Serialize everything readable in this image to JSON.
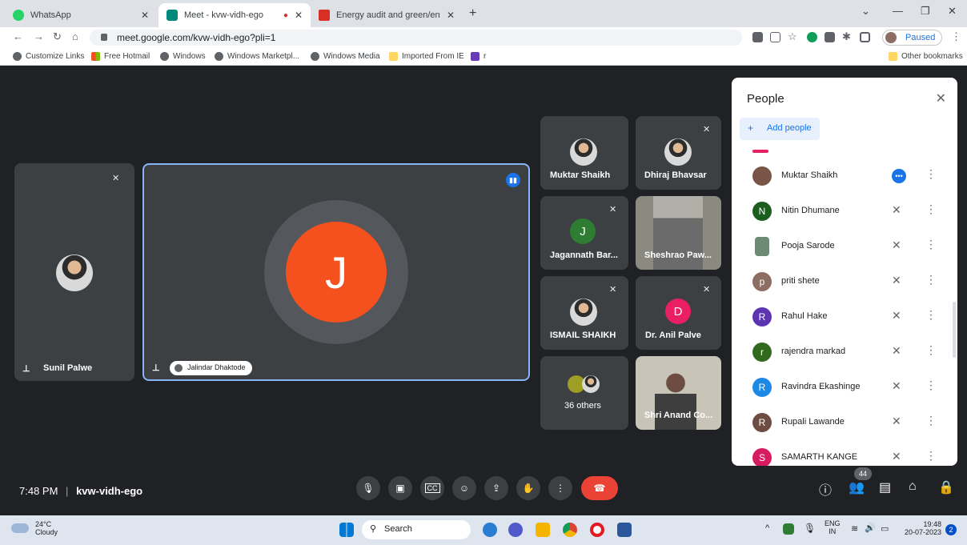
{
  "tabs": [
    {
      "title": "WhatsApp",
      "color": "#25d366"
    },
    {
      "title": "Meet - kvw-vidh-ego",
      "color": "#00897b"
    },
    {
      "title": "Energy audit and green/environm",
      "color": "#d93025"
    }
  ],
  "url": "meet.google.com/kvw-vidh-ego?pli=1",
  "profile_status": "Paused",
  "bookmarks": [
    "Customize Links",
    "Free Hotmail",
    "Windows",
    "Windows Marketpl...",
    "Windows Media",
    "Imported From IE",
    "r"
  ],
  "other_bookmarks": "Other bookmarks",
  "meeting": {
    "time": "7:48 PM",
    "separator": "|",
    "code": "kvw-vidh-ego",
    "main_speaker_initial": "J",
    "main_speaker_name": "Jalindar Dhaktode",
    "pinned_left_name": "Sunil Palwe",
    "tiles": [
      {
        "name": "Muktar Shaikh"
      },
      {
        "name": "Dhiraj Bhavsar"
      },
      {
        "name": "Jagannath Bar...",
        "initial": "J",
        "color": "#2e7d32"
      },
      {
        "name": "Sheshrao Paw..."
      },
      {
        "name": "ISMAIL SHAIKH"
      },
      {
        "name": "Dr. Anil Palve",
        "initial": "D",
        "color": "#e91e63"
      },
      {
        "name": "36 others"
      },
      {
        "name": "Shri Anand Co..."
      }
    ],
    "participant_count": "44"
  },
  "people_panel": {
    "title": "People",
    "add_people": "Add people",
    "participants": [
      {
        "name": "Muktar Shaikh",
        "initial": "",
        "color": "#795548",
        "status": "speaking"
      },
      {
        "name": "Nitin Dhumane",
        "initial": "N",
        "color": "#1b5e20",
        "status": "muted"
      },
      {
        "name": "Pooja Sarode",
        "initial": "",
        "color": "#6d8b74",
        "status": "muted"
      },
      {
        "name": "priti shete",
        "initial": "p",
        "color": "#8d6e63",
        "status": "muted"
      },
      {
        "name": "Rahul Hake",
        "initial": "R",
        "color": "#5e35b1",
        "status": "muted"
      },
      {
        "name": "rajendra markad",
        "initial": "r",
        "color": "#33691e",
        "status": "muted"
      },
      {
        "name": "Ravindra Ekashinge",
        "initial": "R",
        "color": "#1e88e5",
        "status": "muted"
      },
      {
        "name": "Rupali Lawande",
        "initial": "R",
        "color": "#6d4c41",
        "status": "muted"
      },
      {
        "name": "SAMARTH KANGE",
        "initial": "S",
        "color": "#d81b60",
        "status": "muted"
      }
    ]
  },
  "taskbar": {
    "weather_temp": "24°C",
    "weather_desc": "Cloudy",
    "search": "Search",
    "lang1": "ENG",
    "lang2": "IN",
    "clock_time": "19:48",
    "clock_date": "20-07-2023",
    "notif": "2"
  }
}
